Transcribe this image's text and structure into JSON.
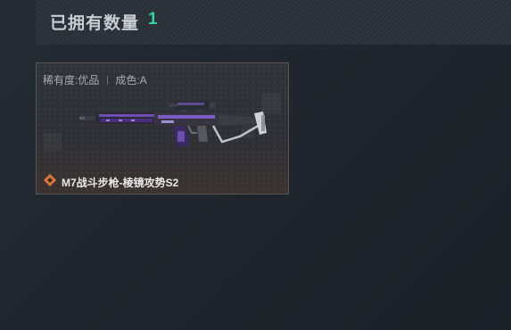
{
  "header": {
    "title": "已拥有数量",
    "count": "1"
  },
  "item": {
    "rarity_label": "稀有度:优品",
    "condition_label": "成色:A",
    "name": "M7战斗步枪-棱镜攻势S2",
    "icon": "diamond-rarity-icon",
    "image": "assault-rifle-skin",
    "rarity_color": "#e0743a"
  },
  "colors": {
    "accent": "#34d399",
    "skin_purple": "#4b2f7e"
  }
}
